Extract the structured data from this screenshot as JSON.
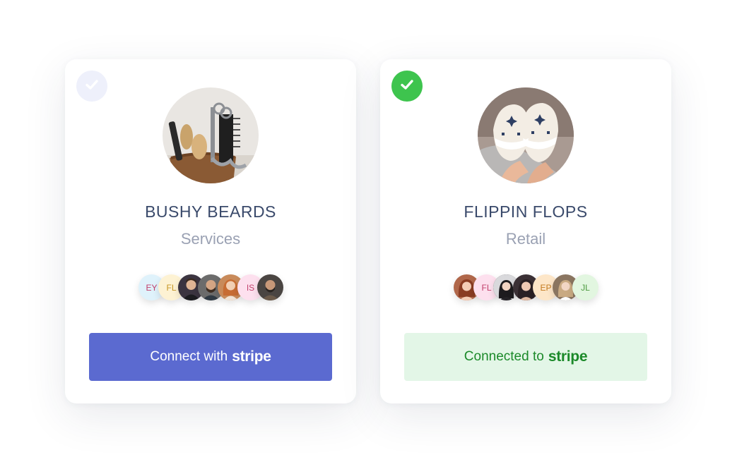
{
  "cards": [
    {
      "name": "BUSHY BEARDS",
      "category": "Services",
      "selected": false,
      "photo_icon": "barber-tools-photo",
      "team": [
        {
          "kind": "initials",
          "text": "EY",
          "bg": "#dff2fb",
          "fg": "#c2406c"
        },
        {
          "kind": "initials",
          "text": "FL",
          "bg": "#fdf2d3",
          "fg": "#c79623"
        },
        {
          "kind": "photo",
          "icon": "person-photo",
          "bg": "#3b3440"
        },
        {
          "kind": "photo",
          "icon": "person-photo",
          "bg": "#6b6b6b"
        },
        {
          "kind": "photo",
          "icon": "person-photo",
          "bg": "#c88a5a"
        },
        {
          "kind": "initials",
          "text": "IS",
          "bg": "#fde0ee",
          "fg": "#c2406c"
        },
        {
          "kind": "photo",
          "icon": "person-photo",
          "bg": "#4a4542"
        }
      ],
      "button": {
        "prefix": "Connect with",
        "brand": "stripe",
        "state": "connect"
      }
    },
    {
      "name": "FLIPPIN FLOPS",
      "category": "Retail",
      "selected": true,
      "photo_icon": "slippers-photo",
      "team": [
        {
          "kind": "photo",
          "icon": "person-photo",
          "bg": "#b0674a"
        },
        {
          "kind": "initials",
          "text": "FL",
          "bg": "#fde0ee",
          "fg": "#c2406c"
        },
        {
          "kind": "photo",
          "icon": "person-photo",
          "bg": "#2f2c30"
        },
        {
          "kind": "photo",
          "icon": "person-photo",
          "bg": "#3a3035"
        },
        {
          "kind": "initials",
          "text": "EP",
          "bg": "#fde6c8",
          "fg": "#c47b1f"
        },
        {
          "kind": "photo",
          "icon": "person-photo",
          "bg": "#8a7560"
        },
        {
          "kind": "initials",
          "text": "JL",
          "bg": "#e2f6e0",
          "fg": "#4c9a3f"
        }
      ],
      "button": {
        "prefix": "Connected to",
        "brand": "stripe",
        "state": "connected"
      }
    }
  ]
}
